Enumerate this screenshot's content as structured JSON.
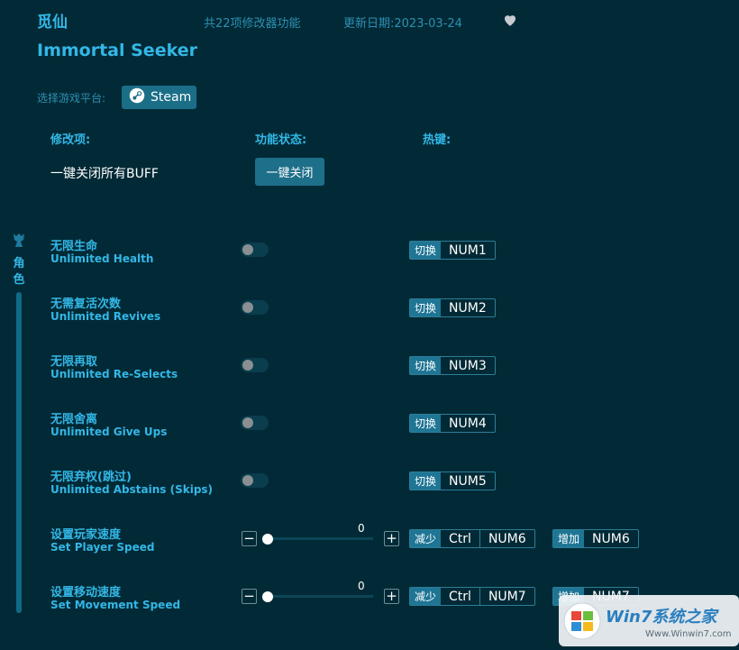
{
  "header": {
    "title_cn": "觅仙",
    "title_en": "Immortal Seeker",
    "feature_count": "共22项修改器功能",
    "update_date": "更新日期:2023-03-24",
    "favorite_icon": "heart-icon"
  },
  "platform": {
    "label": "选择游戏平台:",
    "button_label": "Steam",
    "icon": "steam-icon"
  },
  "columns": {
    "mod": "修改项:",
    "status": "功能状态:",
    "hotkey": "热键:"
  },
  "all_buff": {
    "label": "一键关闭所有BUFF",
    "button": "一键关闭"
  },
  "sidebar": {
    "icon": "character-icon",
    "tab_label_1": "角",
    "tab_label_2": "色"
  },
  "toggle_rows": [
    {
      "cn": "无限生命",
      "en": "Unlimited Health",
      "action": "切换",
      "key": "NUM1",
      "on": false
    },
    {
      "cn": "无需复活次数",
      "en": "Unlimited Revives",
      "action": "切换",
      "key": "NUM2",
      "on": false
    },
    {
      "cn": "无限再取",
      "en": "Unlimited Re-Selects",
      "action": "切换",
      "key": "NUM3",
      "on": false
    },
    {
      "cn": "无限舍离",
      "en": "Unlimited Give Ups",
      "action": "切换",
      "key": "NUM4",
      "on": false
    },
    {
      "cn": "无限弃权(跳过)",
      "en": "Unlimited Abstains (Skips)",
      "action": "切换",
      "key": "NUM5",
      "on": false
    }
  ],
  "slider_rows": [
    {
      "cn": "设置玩家速度",
      "en": "Set Player Speed",
      "value": "0",
      "minus": "−",
      "plus": "+",
      "dec_action": "减少",
      "dec_mod": "Ctrl",
      "dec_key": "NUM6",
      "inc_action": "增加",
      "inc_key": "NUM6"
    },
    {
      "cn": "设置移动速度",
      "en": "Set Movement Speed",
      "value": "0",
      "minus": "−",
      "plus": "+",
      "dec_action": "减少",
      "dec_mod": "Ctrl",
      "dec_key": "NUM7",
      "inc_action": "增加",
      "inc_key": "NUM7"
    }
  ],
  "watermark": {
    "brand": "Win7系统之家",
    "url": "Www.Winwin7.com"
  },
  "colors": {
    "background": "#022a36",
    "accent": "#33b7e6",
    "button": "#1e6f8a"
  }
}
